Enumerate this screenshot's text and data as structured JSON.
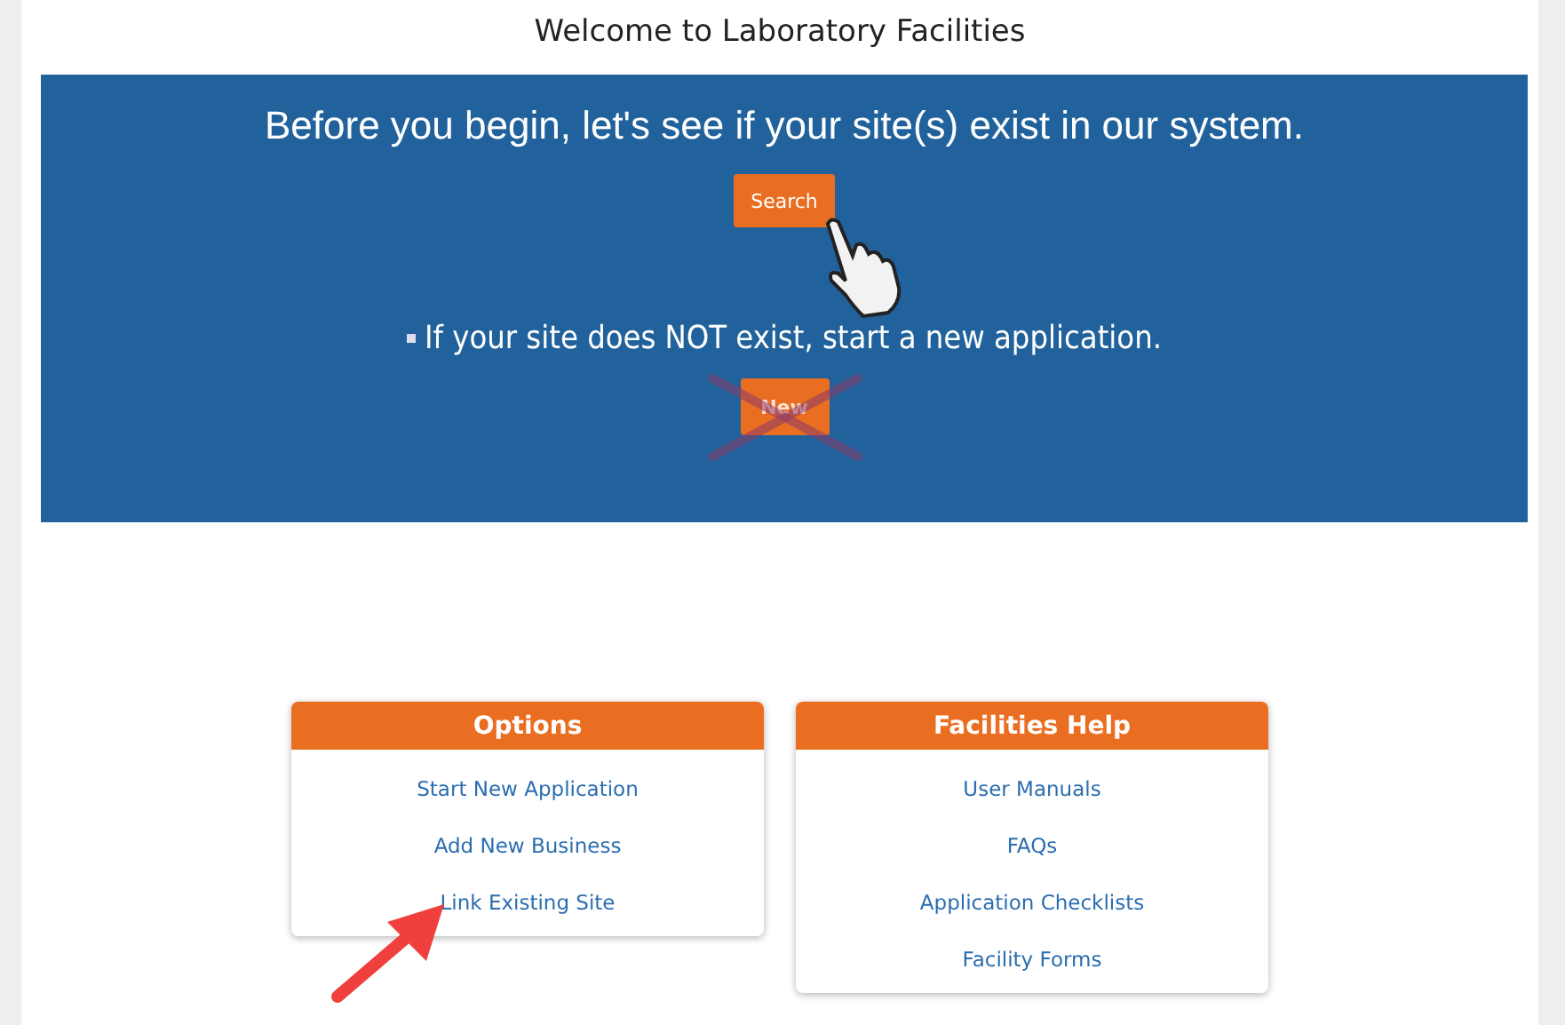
{
  "page_title": "Welcome to Laboratory Facilities",
  "banner": {
    "heading": "Before you begin, let's see if your site(s) exist in our system.",
    "search_button": "Search",
    "note": "If your site does NOT exist, start a new application.",
    "new_button": {
      "label": "New",
      "crossed_out": true
    }
  },
  "cards": [
    {
      "title": "Options",
      "links": [
        "Start New Application",
        "Add New Business",
        "Link Existing Site"
      ],
      "pointer_arrow": true
    },
    {
      "title": "Facilities Help",
      "links": [
        "User Manuals",
        "FAQs",
        "Application Checklists",
        "Facility Forms"
      ],
      "pointer_arrow": false
    }
  ]
}
